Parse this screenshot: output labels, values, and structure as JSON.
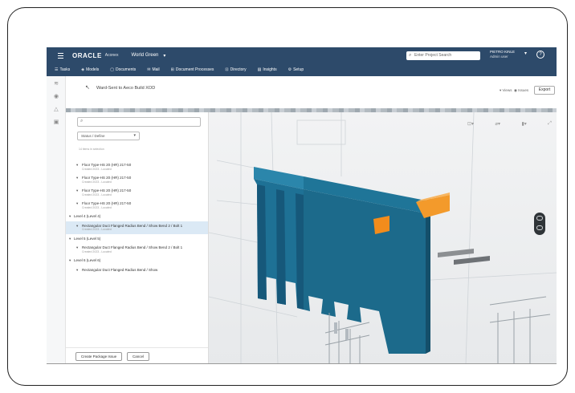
{
  "app": {
    "brand": "ORACLE",
    "brand_sub": "Aconex",
    "project": "World Green",
    "user": "PIETRO KINLE",
    "user_sub": "Admin user"
  },
  "search": {
    "placeholder": "Enter Project Search"
  },
  "nav": [
    {
      "label": "Tasks"
    },
    {
      "label": "Models"
    },
    {
      "label": "Documents"
    },
    {
      "label": "Mail"
    },
    {
      "label": "Document Processes"
    },
    {
      "label": "Directory"
    },
    {
      "label": "Insights"
    },
    {
      "label": "Setup"
    }
  ],
  "titlebar": {
    "title": "Ward-Sent to Aeco Build XOD",
    "views": "Views",
    "issues": "Issues",
    "export": "Export"
  },
  "panel": {
    "status_select": "Status / Define",
    "filter_note": "14 items in selection",
    "tree": [
      {
        "type": "item",
        "title": "Floor Type-HS 20 (HR) 217-50",
        "sub": "Created 2023 - Located"
      },
      {
        "type": "item",
        "title": "Floor Type-HS 20 (HR) 217-50",
        "sub": "Created 2023 - Located"
      },
      {
        "type": "item",
        "title": "Floor Type-HS 20 (HR) 217-50",
        "sub": "Created 2023 - Located"
      },
      {
        "type": "item",
        "title": "Floor Type-HS 20 (HR) 217-50",
        "sub": "Created 2023 - Located"
      },
      {
        "type": "group",
        "title": "Level 4 (Level 4)"
      },
      {
        "type": "item",
        "title": "Rectangular Duct Flanged Radius Bend / Show Bend 2 / Bolt 1",
        "sub": "Created 2023 - Located",
        "selected": true
      },
      {
        "type": "group",
        "title": "Level 5 (Level 5)"
      },
      {
        "type": "item",
        "title": "Rectangular Duct Flanged Radius Bend / Show Bend 2 / Bolt 1",
        "sub": "Created 2023 - Located"
      },
      {
        "type": "group",
        "title": "Level 6 (Level 6)"
      },
      {
        "type": "item",
        "title": "Rectangular Duct Flanged Radius Bend / Show",
        "sub": ""
      }
    ],
    "create_button": "Create Package Issue",
    "cancel_button": "Cancel"
  },
  "colors": {
    "topbar": "#2d4a6a",
    "wall": "#1d6a8c",
    "wall_dark": "#145673",
    "duct": "#f28c1c",
    "selected_row": "#dbe9f5"
  }
}
